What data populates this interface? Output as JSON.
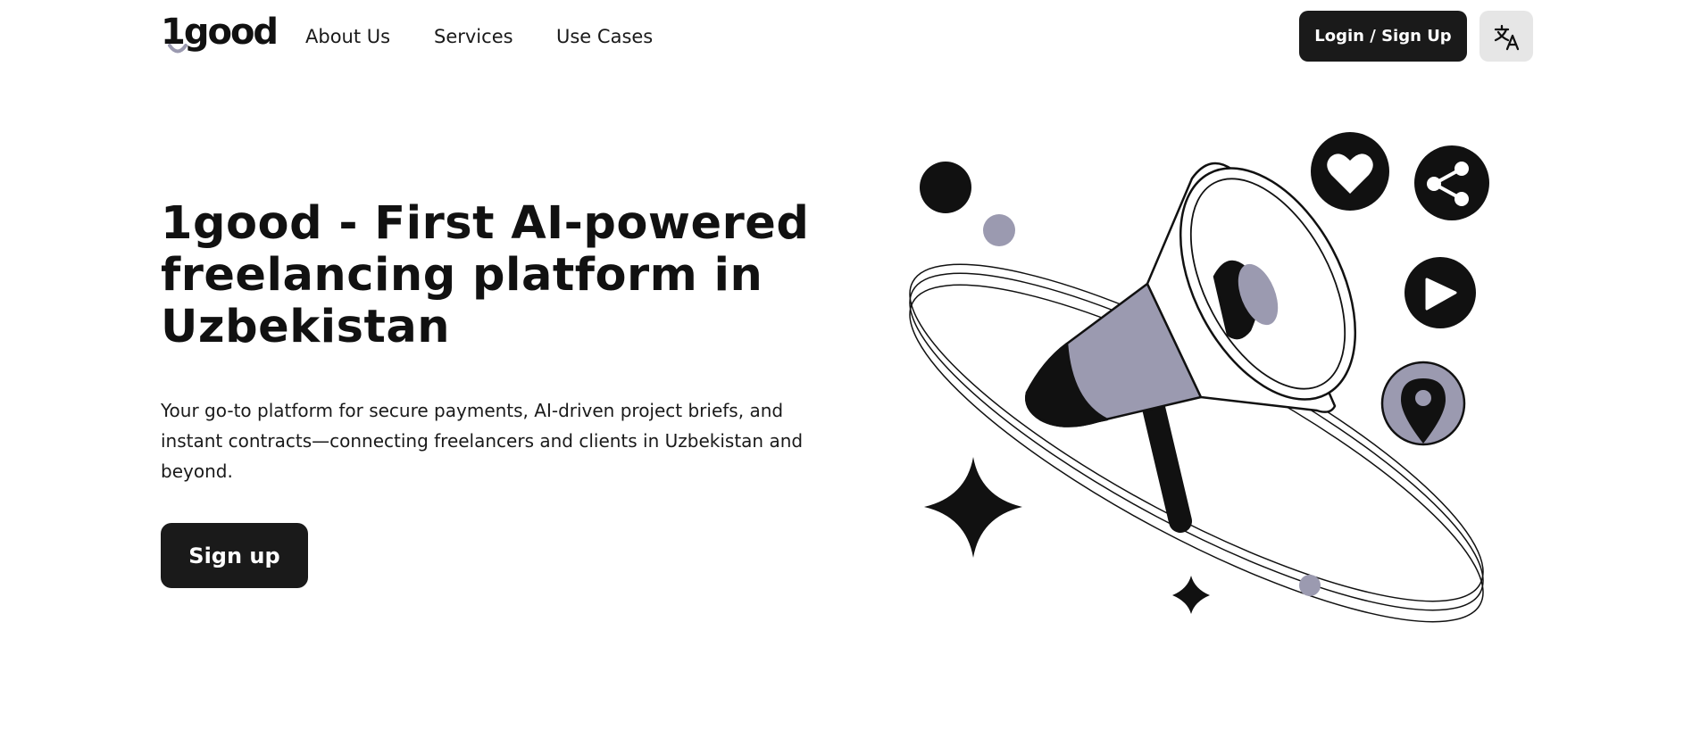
{
  "brand": {
    "name": "1good",
    "accent": "#9b9ab0",
    "dark": "#1a1a1a"
  },
  "nav": {
    "links": [
      "About Us",
      "Services",
      "Use Cases"
    ],
    "login_label": "Login / Sign Up",
    "language_icon": "translate-icon"
  },
  "hero": {
    "title": "1good - First AI-powered freelancing platform in Uzbekistan",
    "description": "Your go-to platform for secure payments, AI-driven project briefs, and instant contracts—connecting freelancers and clients in Uzbekistan and beyond.",
    "cta_label": "Sign up"
  },
  "illustration": {
    "icons": [
      "megaphone-icon",
      "heart-icon",
      "share-icon",
      "play-icon",
      "location-pin-icon",
      "star-icon"
    ]
  }
}
